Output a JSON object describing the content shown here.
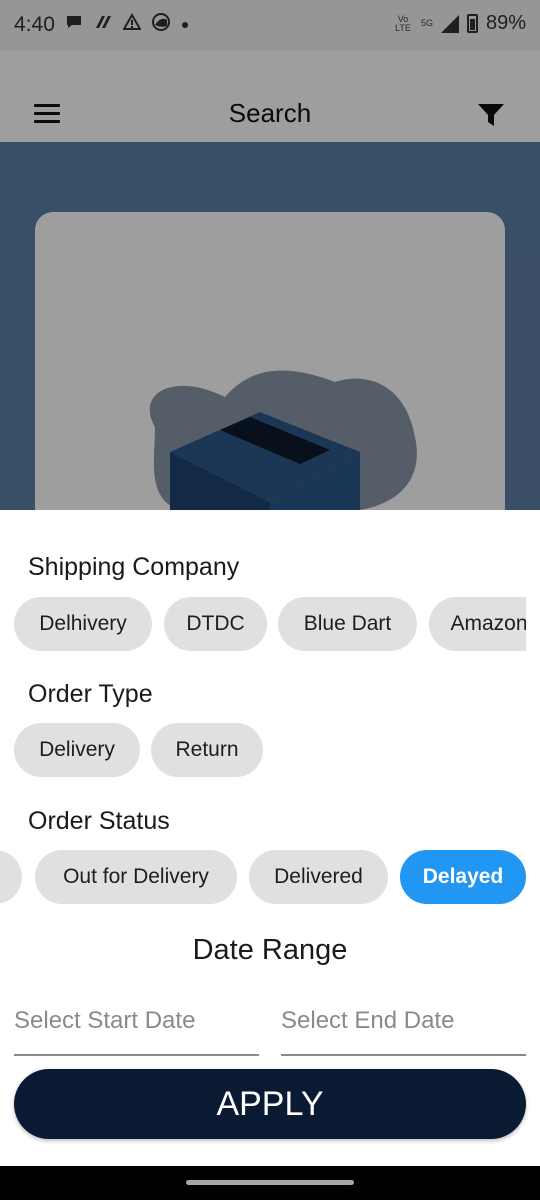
{
  "status_bar": {
    "time": "4:40",
    "volte": "Vo LTE",
    "network": "5G",
    "battery": "89%"
  },
  "app_bar": {
    "title": "Search"
  },
  "filters": {
    "shipping_company": {
      "title": "Shipping Company",
      "chips": [
        "Delhivery",
        "DTDC",
        "Blue Dart",
        "Amazon"
      ]
    },
    "order_type": {
      "title": "Order Type",
      "chips": [
        "Delivery",
        "Return"
      ]
    },
    "order_status": {
      "title": "Order Status",
      "chips": [
        "Out for Delivery",
        "Delivered",
        "Delayed"
      ],
      "selected": "Delayed"
    },
    "date_range": {
      "title": "Date Range",
      "start_placeholder": "Select Start Date",
      "end_placeholder": "Select End Date"
    }
  },
  "apply_button": {
    "label": "APPLY"
  },
  "colors": {
    "selected_chip": "#2196f3",
    "apply_button": "#0b1a33",
    "hero_background": "#5d80a7"
  }
}
